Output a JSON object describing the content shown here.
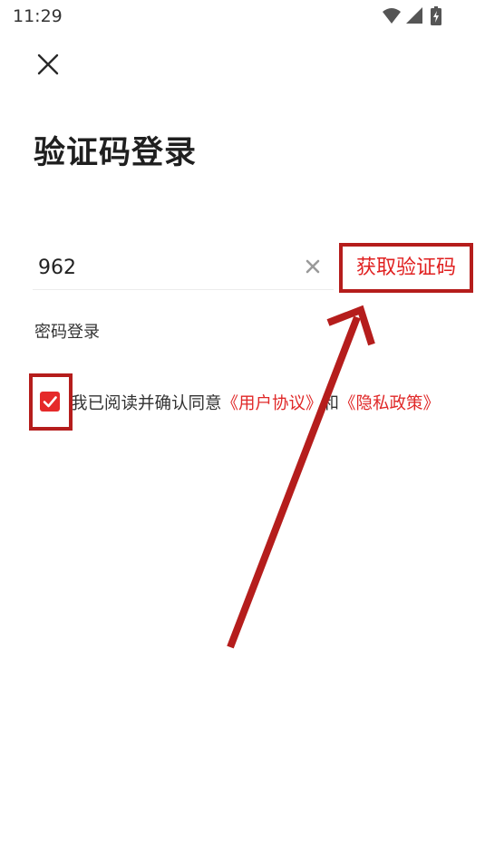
{
  "status_bar": {
    "time": "11:29",
    "icons": [
      "wifi-icon",
      "cell-signal-icon",
      "battery-charging-icon"
    ]
  },
  "nav": {
    "close_icon": "close-icon"
  },
  "page": {
    "title": "验证码登录"
  },
  "code_field": {
    "value": "962",
    "clear_icon": "clear-icon",
    "get_code_label": "获取验证码"
  },
  "password_login_label": "密码登录",
  "agreement": {
    "checked": true,
    "prefix": "我已阅读并确认同意",
    "user_agreement": "《用户协议》",
    "conjunction": "和",
    "privacy_policy": "《隐私政策》"
  },
  "colors": {
    "accent_red": "#e02020",
    "annotation_red": "#b51d1c"
  }
}
